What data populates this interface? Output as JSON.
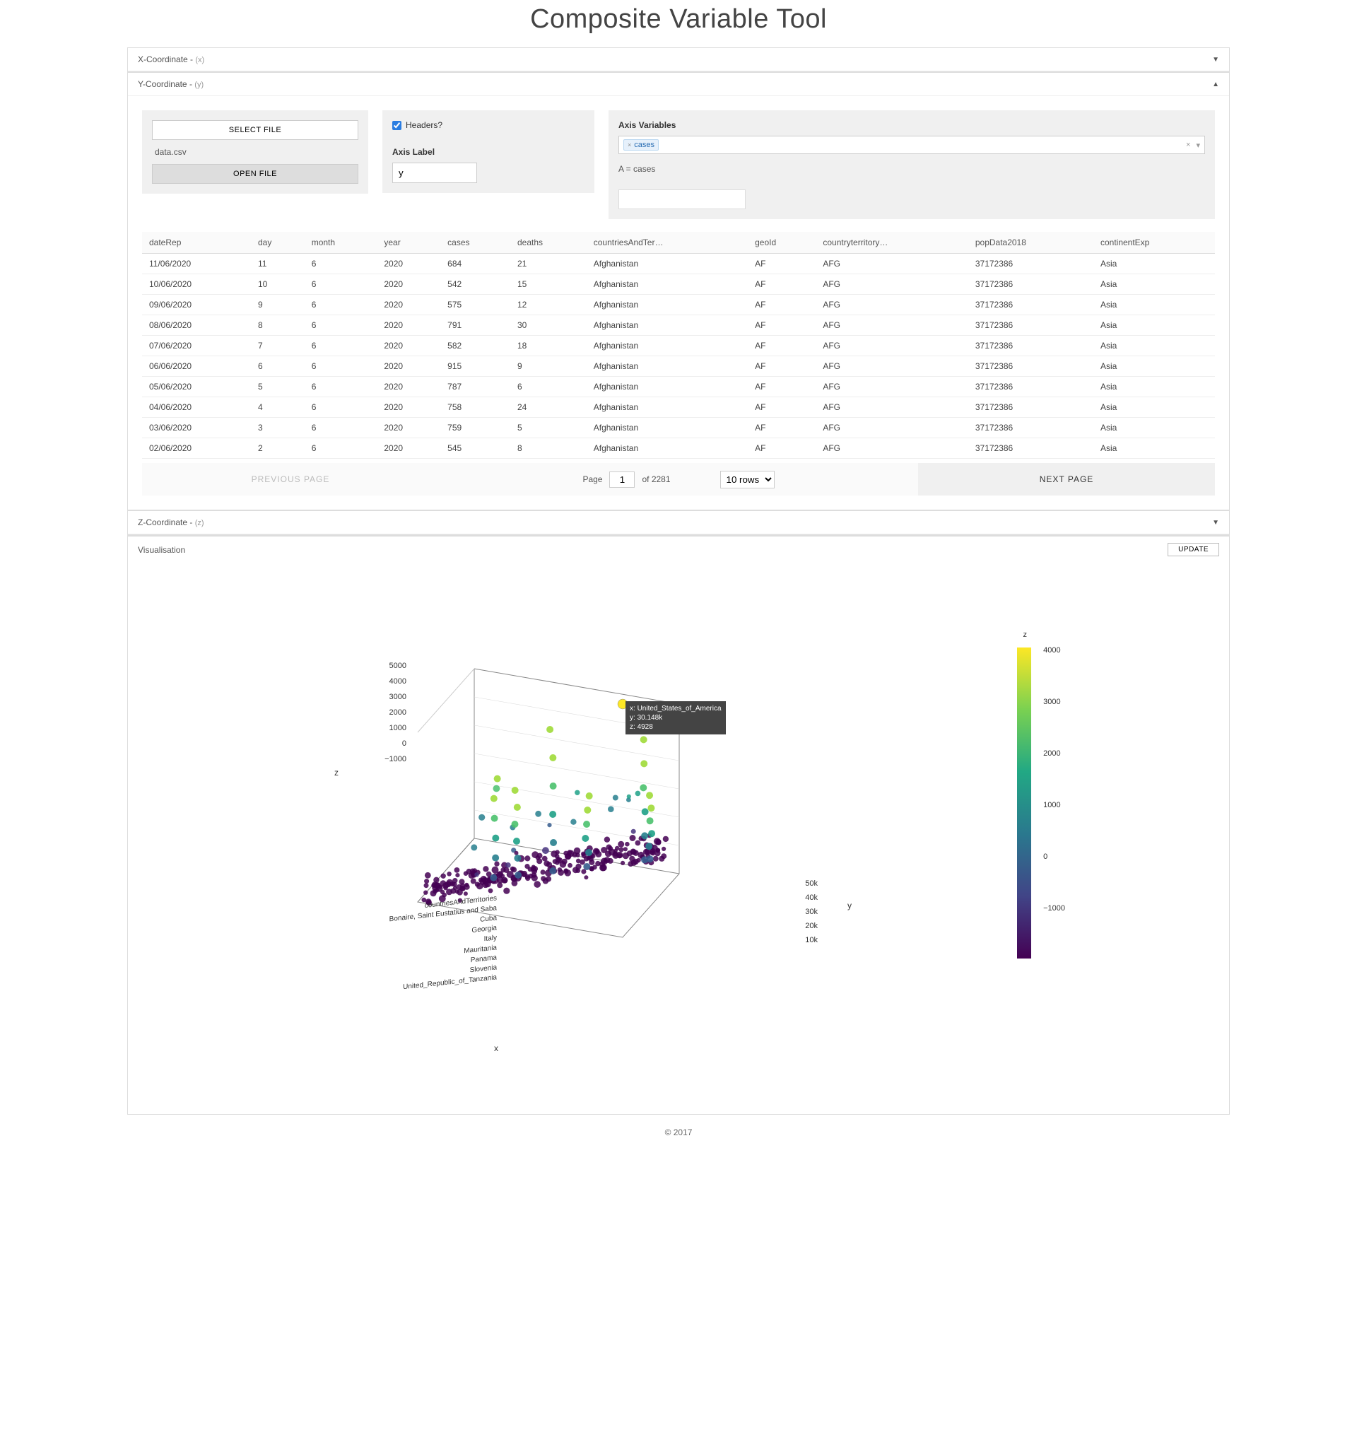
{
  "title": "Composite Variable Tool",
  "panels": {
    "x": {
      "label": "X-Coordinate - ",
      "var": "(x)",
      "collapsed": true
    },
    "y": {
      "label": "Y-Coordinate - ",
      "var": "(y)",
      "collapsed": false
    },
    "z": {
      "label": "Z-Coordinate - ",
      "var": "(z)",
      "collapsed": true
    },
    "viz": {
      "label": "Visualisation",
      "update": "UPDATE"
    }
  },
  "file": {
    "select": "SELECT FILE",
    "name": "data.csv",
    "open": "OPEN FILE"
  },
  "headers": {
    "checkbox": "Headers?",
    "axis_label_title": "Axis Label",
    "axis_label_value": "y"
  },
  "axisvars": {
    "title": "Axis Variables",
    "tags": [
      "cases"
    ],
    "expr": "A = cases"
  },
  "table": {
    "columns": [
      "dateRep",
      "day",
      "month",
      "year",
      "cases",
      "deaths",
      "countriesAndTer…",
      "geoId",
      "countryterritory…",
      "popData2018",
      "continentExp"
    ],
    "rows": [
      [
        "11/06/2020",
        "11",
        "6",
        "2020",
        "684",
        "21",
        "Afghanistan",
        "AF",
        "AFG",
        "37172386",
        "Asia"
      ],
      [
        "10/06/2020",
        "10",
        "6",
        "2020",
        "542",
        "15",
        "Afghanistan",
        "AF",
        "AFG",
        "37172386",
        "Asia"
      ],
      [
        "09/06/2020",
        "9",
        "6",
        "2020",
        "575",
        "12",
        "Afghanistan",
        "AF",
        "AFG",
        "37172386",
        "Asia"
      ],
      [
        "08/06/2020",
        "8",
        "6",
        "2020",
        "791",
        "30",
        "Afghanistan",
        "AF",
        "AFG",
        "37172386",
        "Asia"
      ],
      [
        "07/06/2020",
        "7",
        "6",
        "2020",
        "582",
        "18",
        "Afghanistan",
        "AF",
        "AFG",
        "37172386",
        "Asia"
      ],
      [
        "06/06/2020",
        "6",
        "6",
        "2020",
        "915",
        "9",
        "Afghanistan",
        "AF",
        "AFG",
        "37172386",
        "Asia"
      ],
      [
        "05/06/2020",
        "5",
        "6",
        "2020",
        "787",
        "6",
        "Afghanistan",
        "AF",
        "AFG",
        "37172386",
        "Asia"
      ],
      [
        "04/06/2020",
        "4",
        "6",
        "2020",
        "758",
        "24",
        "Afghanistan",
        "AF",
        "AFG",
        "37172386",
        "Asia"
      ],
      [
        "03/06/2020",
        "3",
        "6",
        "2020",
        "759",
        "5",
        "Afghanistan",
        "AF",
        "AFG",
        "37172386",
        "Asia"
      ],
      [
        "02/06/2020",
        "2",
        "6",
        "2020",
        "545",
        "8",
        "Afghanistan",
        "AF",
        "AFG",
        "37172386",
        "Asia"
      ]
    ]
  },
  "pager": {
    "prev": "PREVIOUS PAGE",
    "next": "NEXT PAGE",
    "page_label": "Page",
    "page_value": "1",
    "of": "of 2281",
    "rows_select": "10 rows"
  },
  "chart_data": {
    "type": "scatter",
    "title": "",
    "axes": {
      "x": {
        "label": "x",
        "category_label": "countriesAndTerritories",
        "categories": [
          "Bonaire, Saint Eustatius and Saba",
          "Cuba",
          "Georgia",
          "Italy",
          "Mauritania",
          "Panama",
          "Slovenia",
          "United_Republic_of_Tanzania"
        ]
      },
      "y": {
        "label": "y",
        "ticks": [
          "10k",
          "20k",
          "30k",
          "40k",
          "50k"
        ],
        "range": [
          0,
          50000
        ]
      },
      "z": {
        "label": "z",
        "ticks": [
          "5000",
          "4000",
          "3000",
          "2000",
          "1000",
          "0",
          "−1000"
        ],
        "range": [
          -1000,
          5000
        ]
      }
    },
    "colorbar": {
      "label": "z",
      "ticks": [
        "4000",
        "3000",
        "2000",
        "1000",
        "0",
        "−1000"
      ],
      "scheme": "viridis"
    },
    "hover_point": {
      "x": "United_States_of_America",
      "y": "30.148k",
      "z": "4928"
    }
  },
  "footer": "© 2017"
}
